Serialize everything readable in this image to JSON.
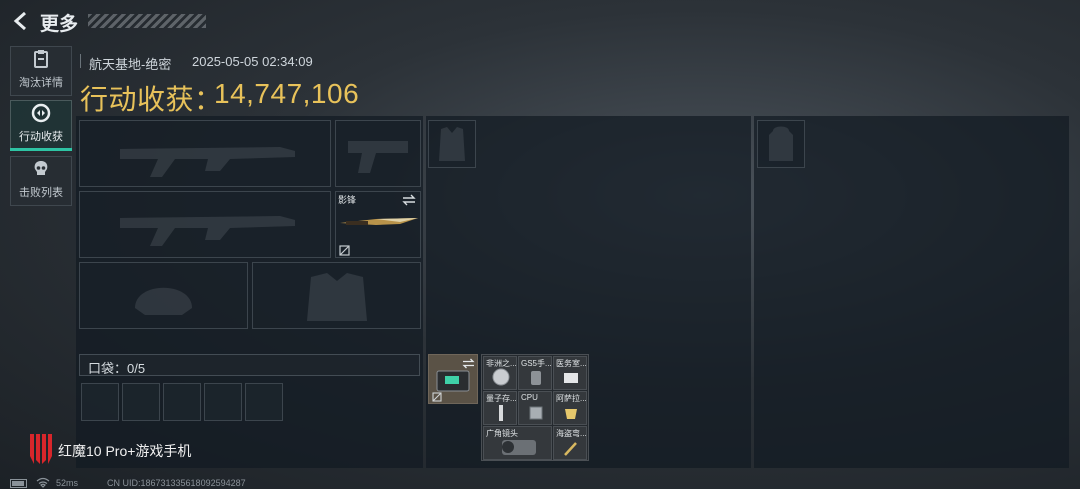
{
  "header": {
    "title": "更多"
  },
  "tabs": [
    {
      "label": "淘汰详情",
      "icon": "clipboard-icon"
    },
    {
      "label": "行动收获",
      "icon": "loot-icon",
      "active": true
    },
    {
      "label": "击败列表",
      "icon": "skull-icon"
    }
  ],
  "match": {
    "map": "航天基地-绝密",
    "datetime": "2025-05-05 02:34:09"
  },
  "harvest": {
    "label": "行动收获：",
    "value": "14,747,106"
  },
  "equipment": {
    "knife_name": "影锋"
  },
  "pocket": {
    "label": "口袋：0/5",
    "slots_total": 5
  },
  "container_items": [
    {
      "label": "非洲之..."
    },
    {
      "label": "GS5手..."
    },
    {
      "label": "医务室..."
    },
    {
      "label": "量子存..."
    },
    {
      "label": "CPU"
    },
    {
      "label": "阿萨拉..."
    },
    {
      "label": "广角镜头"
    },
    {
      "label": ""
    },
    {
      "label": "海盗弯..."
    }
  ],
  "watermark": {
    "brand": "红魔10 Pro+游戏手机"
  },
  "status": {
    "ping": "52ms",
    "uid": "CN UID:1867313356180925942​87"
  },
  "colors": {
    "accent": "#2ec4a4",
    "gold": "#e8c25a"
  }
}
